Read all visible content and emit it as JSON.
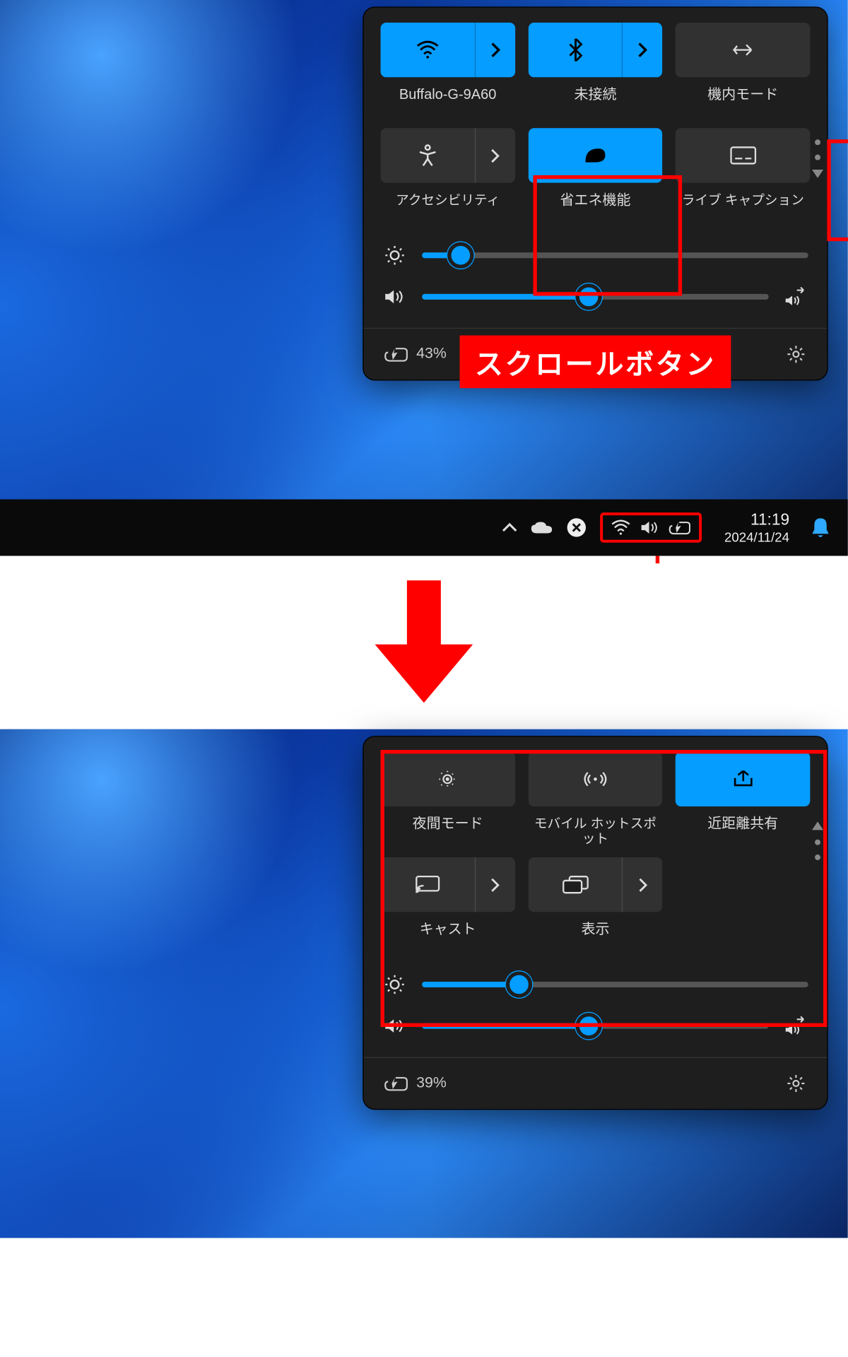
{
  "annotation": {
    "scroll_label": "スクロールボタン"
  },
  "qs1": {
    "wifi": {
      "label": "Buffalo-G-9A60"
    },
    "bluetooth": {
      "label": "未接続"
    },
    "airplane": {
      "label": "機内モード"
    },
    "accessibility": {
      "label": "アクセシビリティ"
    },
    "energy": {
      "label": "省エネ機能"
    },
    "caption": {
      "label": "ライブ キャプション"
    },
    "brightness": {
      "pct": 10
    },
    "volume": {
      "pct": 48
    },
    "battery": {
      "text": "43%"
    }
  },
  "qs2": {
    "night": {
      "label": "夜間モード"
    },
    "hotspot": {
      "label": "モバイル ホットスポット"
    },
    "share": {
      "label": "近距離共有"
    },
    "cast": {
      "label": "キャスト"
    },
    "project": {
      "label": "表示"
    },
    "brightness": {
      "pct": 25
    },
    "volume": {
      "pct": 48
    },
    "battery": {
      "text": "39%"
    }
  },
  "taskbar": {
    "time": "11:19",
    "date": "2024/11/24"
  },
  "colors": {
    "accent": "#059dff",
    "highlight": "#ff0000"
  }
}
